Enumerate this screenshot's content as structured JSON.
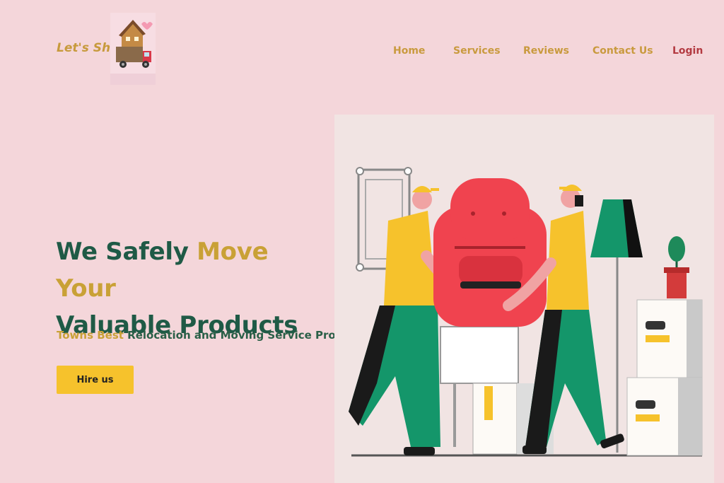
{
  "brand": {
    "name": "Let's Shift",
    "logo_icon": "moving-truck-with-house-icon"
  },
  "nav": {
    "items": [
      {
        "label": "Home"
      },
      {
        "label": "Services"
      },
      {
        "label": "Reviews"
      },
      {
        "label": "Contact Us"
      },
      {
        "label": "Login"
      }
    ]
  },
  "hero": {
    "title_part1": "We Safely ",
    "title_accent": "Move Your",
    "title_part2": "Valuable Products",
    "tagline_accent": "Towns Best",
    "tagline_rest": " Relocation and Moving Service Provider",
    "cta_label": "Hire us",
    "illustration_icon": "movers-carrying-armchair-illustration"
  },
  "colors": {
    "background": "#f4d6da",
    "accent_gold": "#c9a136",
    "heading_green": "#1f5a46",
    "button_yellow": "#f6c22c",
    "login_red": "#b33a41"
  }
}
